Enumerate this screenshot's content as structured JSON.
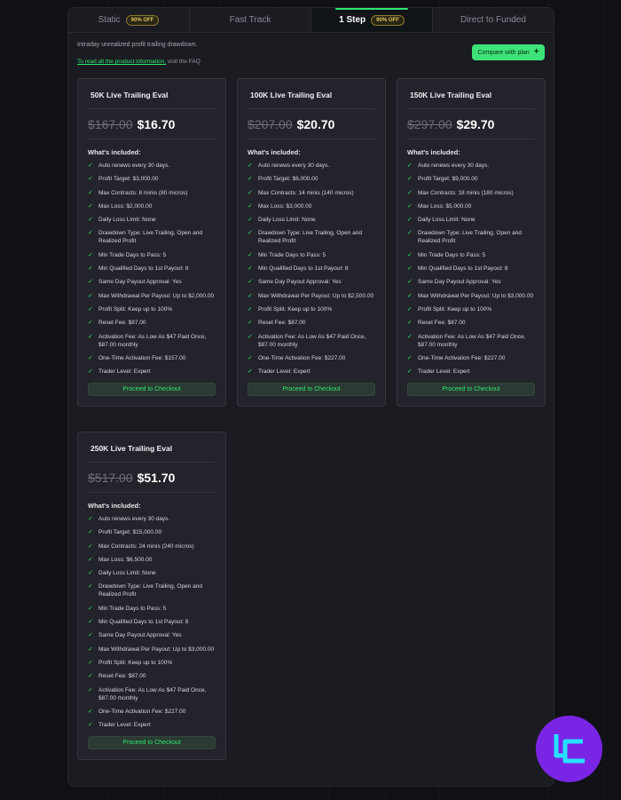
{
  "tabs": [
    {
      "label": "Static",
      "badge": "90% OFF",
      "active": false
    },
    {
      "label": "Fast Track",
      "badge": "",
      "active": false
    },
    {
      "label": "1 Step",
      "badge": "90% OFF",
      "active": true
    },
    {
      "label": "Direct to Funded",
      "badge": "",
      "active": false
    }
  ],
  "intro": "Intraday unrealized profit trailing drawdown.",
  "faq": {
    "link": "To read all the product information,",
    "rest": " visit the FAQ"
  },
  "compare_button": "Compare with plan",
  "included_label": "What's included:",
  "checkout_label": "Proceed to Checkout",
  "plans": [
    {
      "title": "50K Live Trailing Eval",
      "old_price": "$167.00",
      "price": "$16.70",
      "features": [
        "Auto renews every 30 days.",
        "Profit Target: $3,000.00",
        "Max Contracts: 8 minis (80 micros)",
        "Max Loss: $2,000.00",
        "Daily Loss Limit: None",
        "Drawdown Type: Live Trailing, Open and Realized Profit",
        "Min Trade Days to Pass: 5",
        "Min Qualified Days to 1st Payout: 8",
        "Same Day Payout Approval: Yes",
        "Max Withdrawal Per Payout: Up to $2,000.00",
        "Profit Split: Keep up to 100%",
        "Reset Fee: $87.00",
        "Activation Fee: As Low As $47 Paid Once, $87.00 monthly",
        "One-Time Activation Fee: $157.00",
        "Trader Level: Expert"
      ]
    },
    {
      "title": "100K Live Trailing Eval",
      "old_price": "$207.00",
      "price": "$20.70",
      "features": [
        "Auto renews every 30 days.",
        "Profit Target: $6,000.00",
        "Max Contracts: 14 minis (140 micros)",
        "Max Loss: $3,000.00",
        "Daily Loss Limit: None",
        "Drawdown Type: Live Trailing, Open and Realized Profit",
        "Min Trade Days to Pass: 5",
        "Min Qualified Days to 1st Payout: 8",
        "Same Day Payout Approval: Yes",
        "Max Withdrawal Per Payout: Up to $2,500.00",
        "Profit Split: Keep up to 100%",
        "Reset Fee: $87.00",
        "Activation Fee: As Low As $47 Paid Once, $87.00 monthly",
        "One-Time Activation Fee: $227.00",
        "Trader Level: Expert"
      ]
    },
    {
      "title": "150K Live Trailing Eval",
      "old_price": "$297.00",
      "price": "$29.70",
      "features": [
        "Auto renews every 30 days.",
        "Profit Target: $9,000.00",
        "Max Contracts: 18 minis (180 micros)",
        "Max Loss: $5,000.00",
        "Daily Loss Limit: None",
        "Drawdown Type: Live Trailing, Open and Realized Profit",
        "Min Trade Days to Pass: 5",
        "Min Qualified Days to 1st Payout: 8",
        "Same Day Payout Approval: Yes",
        "Max Withdrawal Per Payout: Up to $3,000.00",
        "Profit Split: Keep up to 100%",
        "Reset Fee: $87.00",
        "Activation Fee: As Low As $47 Paid Once, $87.00 monthly",
        "One-Time Activation Fee: $227.00",
        "Trader Level: Expert"
      ]
    },
    {
      "title": "250K Live Trailing Eval",
      "old_price": "$517.00",
      "price": "$51.70",
      "features": [
        "Auto renews every 30 days.",
        "Profit Target: $15,000.00",
        "Max Contracts: 24 minis (240 micros)",
        "Max Loss: $6,500.00",
        "Daily Loss Limit: None",
        "Drawdown Type: Live Trailing, Open and Realized Profit",
        "Min Trade Days to Pass: 5",
        "Min Qualified Days to 1st Payout: 8",
        "Same Day Payout Approval: Yes",
        "Max Withdrawal Per Payout: Up to $3,000.00",
        "Profit Split: Keep up to 100%",
        "Reset Fee: $87.00",
        "Activation Fee: As Low As $47 Paid Once, $87.00 monthly",
        "One-Time Activation Fee: $227.00",
        "Trader Level: Expert"
      ]
    }
  ],
  "colors": {
    "accent": "#2ee56f",
    "logo": "#7a25e6",
    "logo_mark": "#27e0ff"
  },
  "icons": {
    "check": "check-icon",
    "plus": "plus-icon",
    "logo": "brand-logo"
  }
}
